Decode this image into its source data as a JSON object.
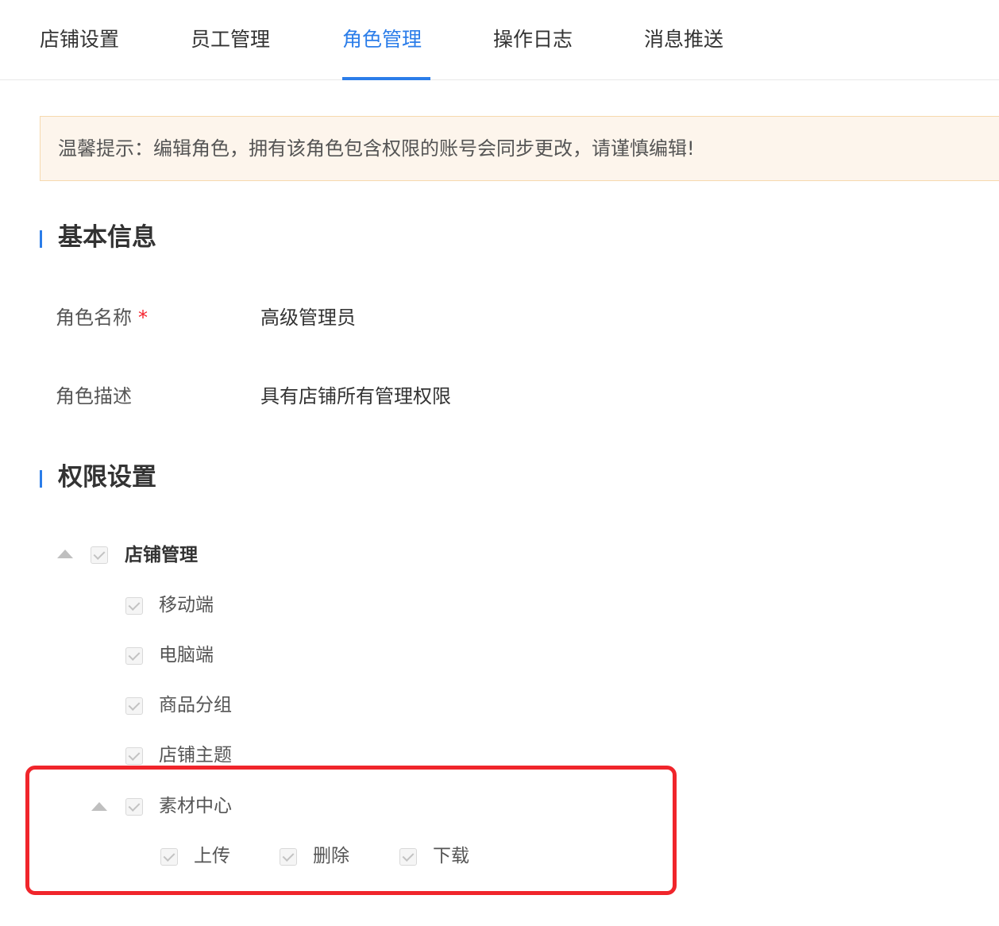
{
  "tabs": [
    {
      "label": "店铺设置",
      "active": false
    },
    {
      "label": "员工管理",
      "active": false
    },
    {
      "label": "角色管理",
      "active": true
    },
    {
      "label": "操作日志",
      "active": false
    },
    {
      "label": "消息推送",
      "active": false
    }
  ],
  "notice": {
    "text": "温馨提示：编辑角色，拥有该角色包含权限的账号会同步更改，请谨慎编辑!"
  },
  "basic_info": {
    "title": "基本信息",
    "role_name_label": "角色名称",
    "required_mark": "*",
    "role_name_value": "高级管理员",
    "role_desc_label": "角色描述",
    "role_desc_value": "具有店铺所有管理权限"
  },
  "permissions": {
    "title": "权限设置",
    "tree": {
      "label": "店铺管理",
      "checked": true,
      "expanded": true,
      "children": [
        {
          "label": "移动端",
          "checked": true
        },
        {
          "label": "电脑端",
          "checked": true
        },
        {
          "label": "商品分组",
          "checked": true
        },
        {
          "label": "店铺主题",
          "checked": true
        },
        {
          "label": "素材中心",
          "checked": true,
          "expanded": true,
          "children": [
            {
              "label": "上传",
              "checked": true
            },
            {
              "label": "删除",
              "checked": true
            },
            {
              "label": "下载",
              "checked": true
            }
          ]
        }
      ]
    }
  },
  "colors": {
    "accent": "#2b7de9",
    "notice_bg": "#fdf5ec",
    "notice_border": "#f6d9ae",
    "required": "#f5222d",
    "highlight": "#f0252b"
  },
  "icons": {
    "caret": "caret-up-icon",
    "checkbox": "checkbox-checked-disabled-icon"
  }
}
